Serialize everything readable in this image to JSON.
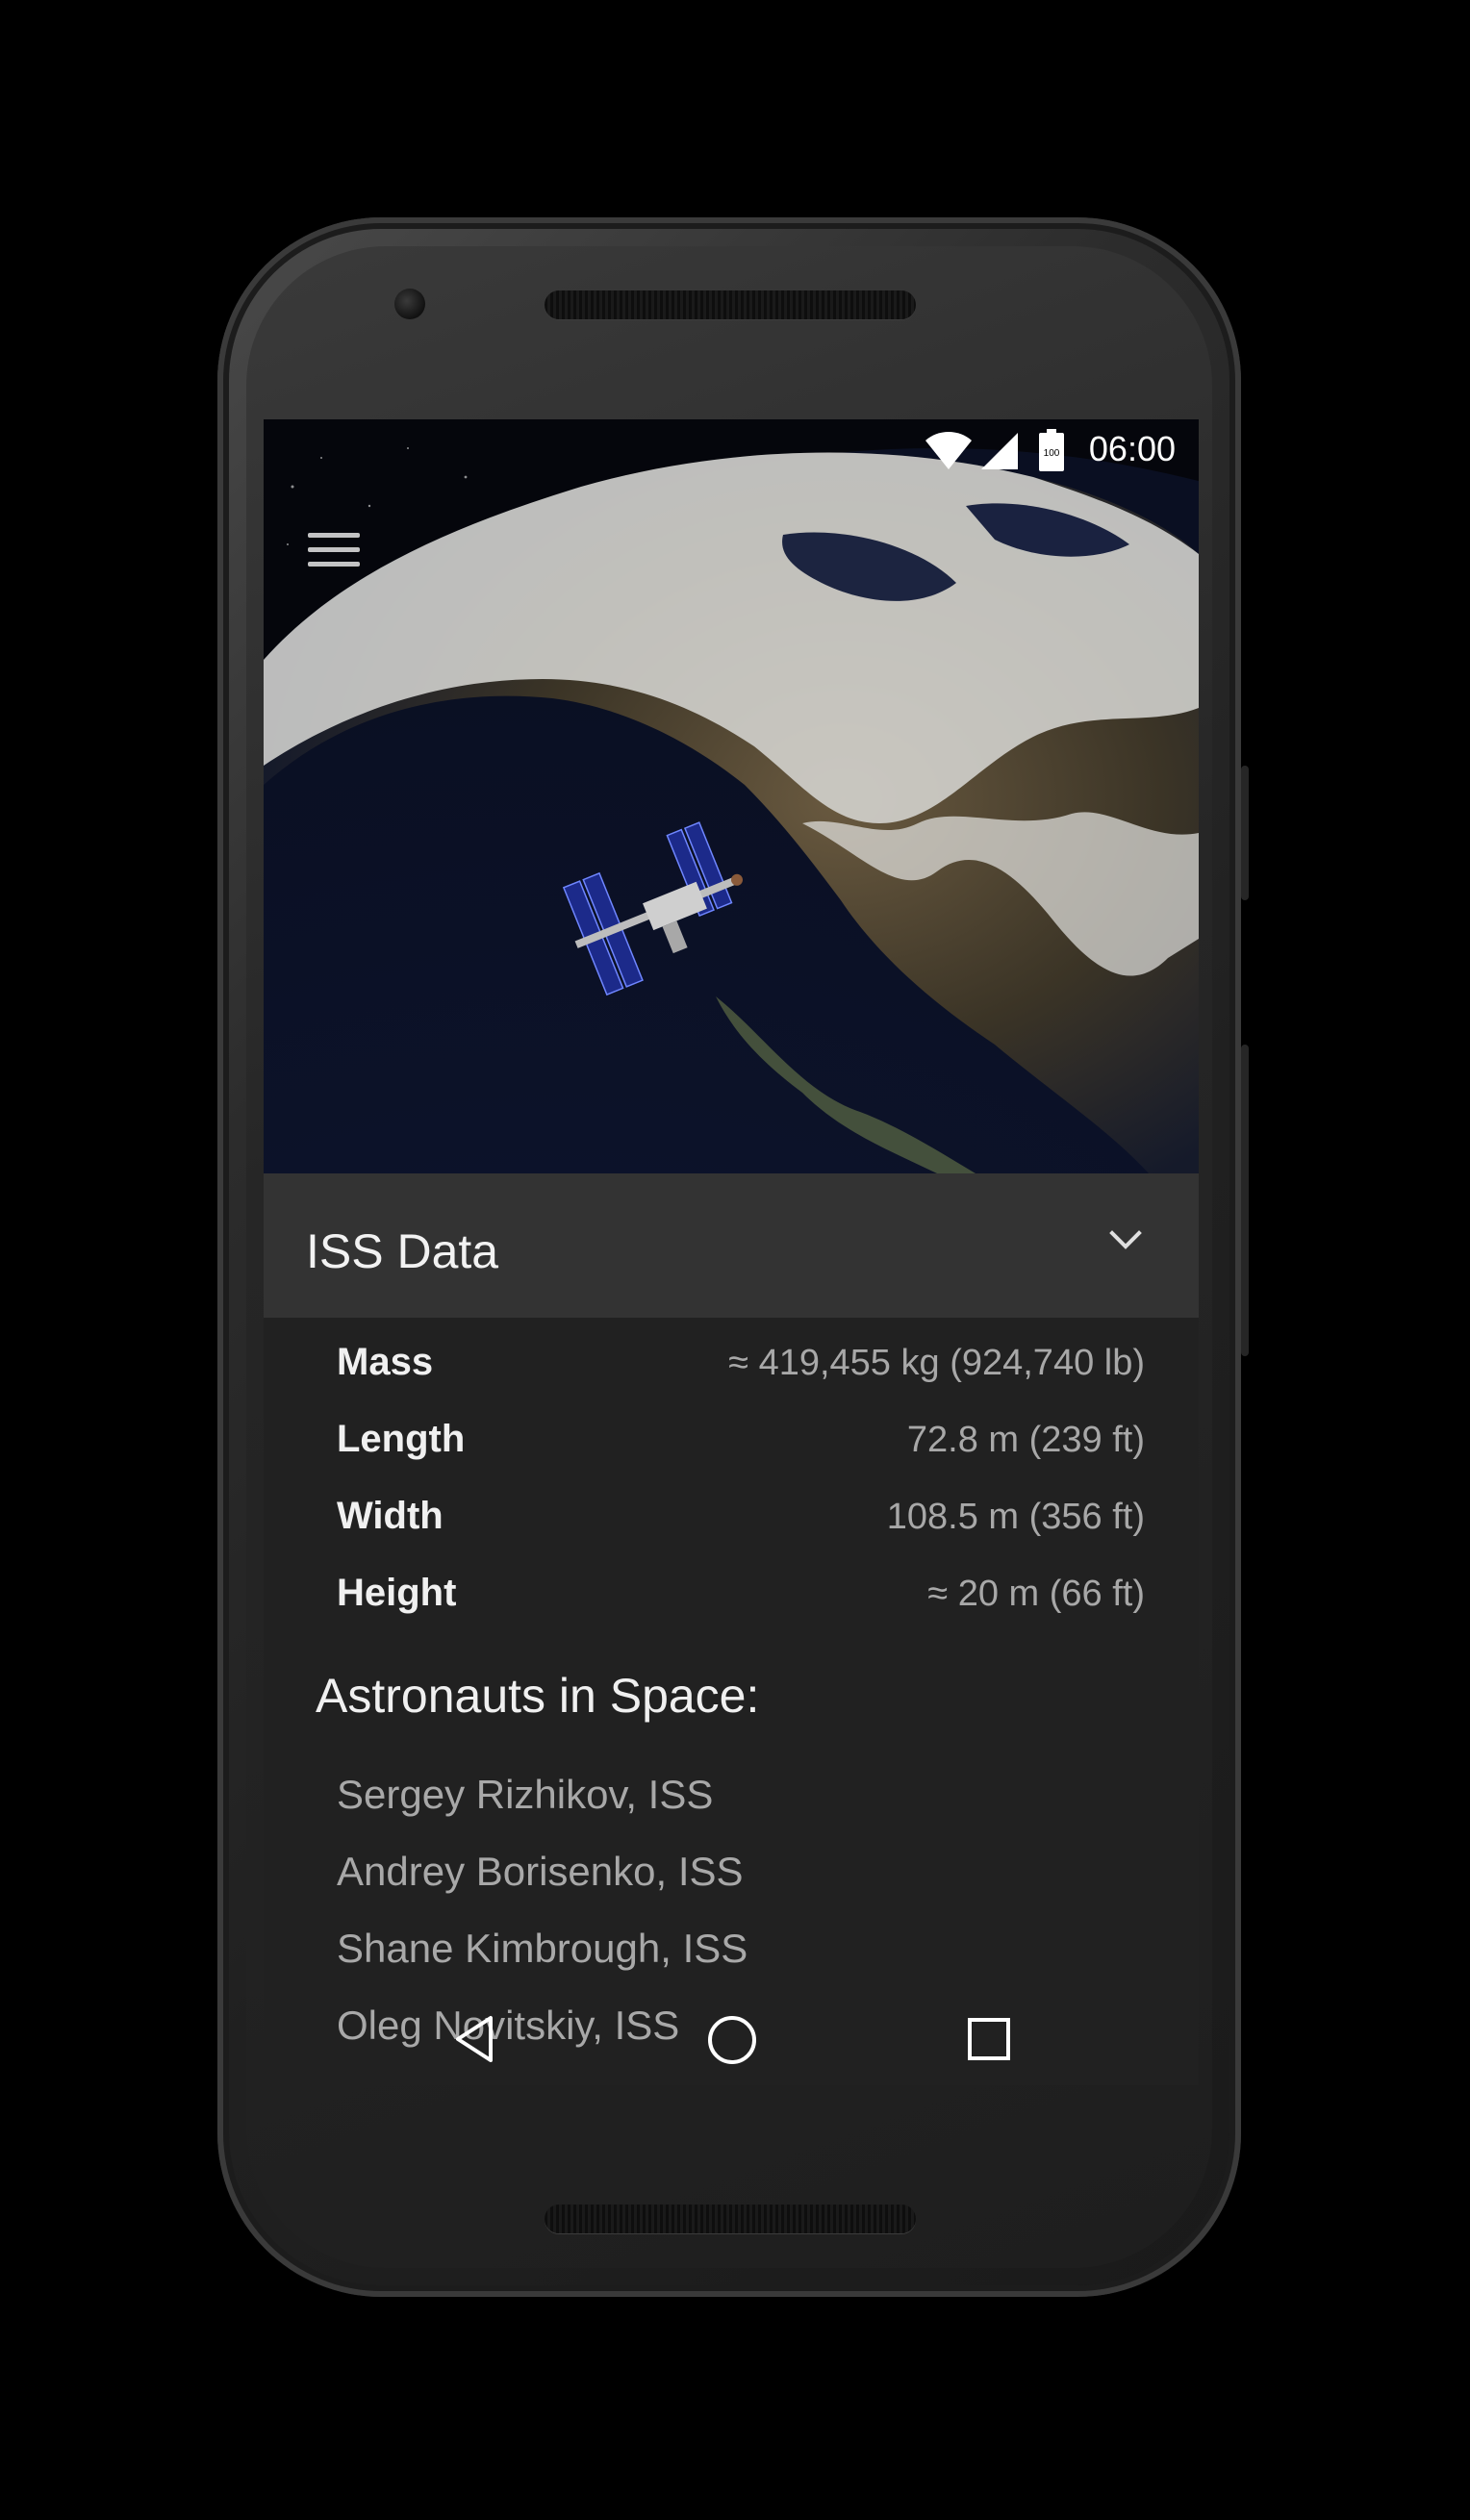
{
  "status_bar": {
    "time": "06:00",
    "battery": "100"
  },
  "header": {
    "title": "ISS Data"
  },
  "iss_data": [
    {
      "label": "Mass",
      "value": "≈ 419,455 kg (924,740 lb)"
    },
    {
      "label": "Length",
      "value": "72.8 m (239 ft)"
    },
    {
      "label": "Width",
      "value": "108.5 m (356 ft)"
    },
    {
      "label": "Height",
      "value": "≈ 20 m (66 ft)"
    }
  ],
  "astronauts": {
    "title": "Astronauts in Space:",
    "items": [
      {
        "name": "Sergey Rizhikov, ISS"
      },
      {
        "name": "Andrey Borisenko, ISS"
      },
      {
        "name": "Shane Kimbrough, ISS"
      },
      {
        "name": "Oleg Novitskiy, ISS"
      }
    ]
  },
  "icons": {
    "menu": "menu-icon",
    "expand": "chevron-down-icon",
    "nav_back": "back-triangle-icon",
    "nav_home": "home-circle-icon",
    "nav_recents": "recents-square-icon"
  },
  "colors": {
    "screen_bg": "#212121",
    "header_bg": "#333333",
    "text_primary": "#f0f0f0",
    "text_secondary": "#a8a8a8"
  }
}
